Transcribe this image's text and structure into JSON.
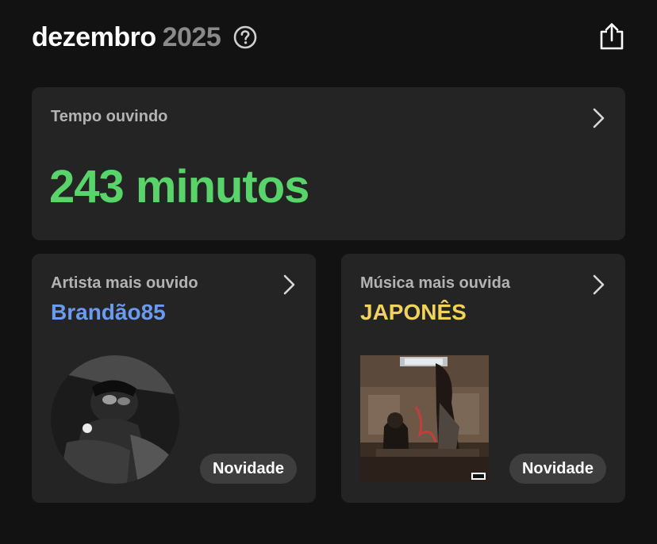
{
  "header": {
    "month": "dezembro",
    "year": "2025",
    "help_icon": "question-circle-icon",
    "share_icon": "share-upload-icon"
  },
  "listening_time": {
    "label": "Tempo ouvindo",
    "value": "243 minutos",
    "accent_color": "#59d46a"
  },
  "top_artist": {
    "label": "Artista mais ouvido",
    "name": "Brandão85",
    "badge": "Novidade",
    "accent_color": "#6b9bf1"
  },
  "top_song": {
    "label": "Música mais ouvida",
    "name": "JAPONÊS",
    "badge": "Novidade",
    "accent_color": "#f2d35a"
  },
  "colors": {
    "background": "#121212",
    "card": "#242424",
    "badge": "#3e3e3e",
    "muted_text": "#b3b3b3",
    "year_text": "#8a8a8a"
  }
}
